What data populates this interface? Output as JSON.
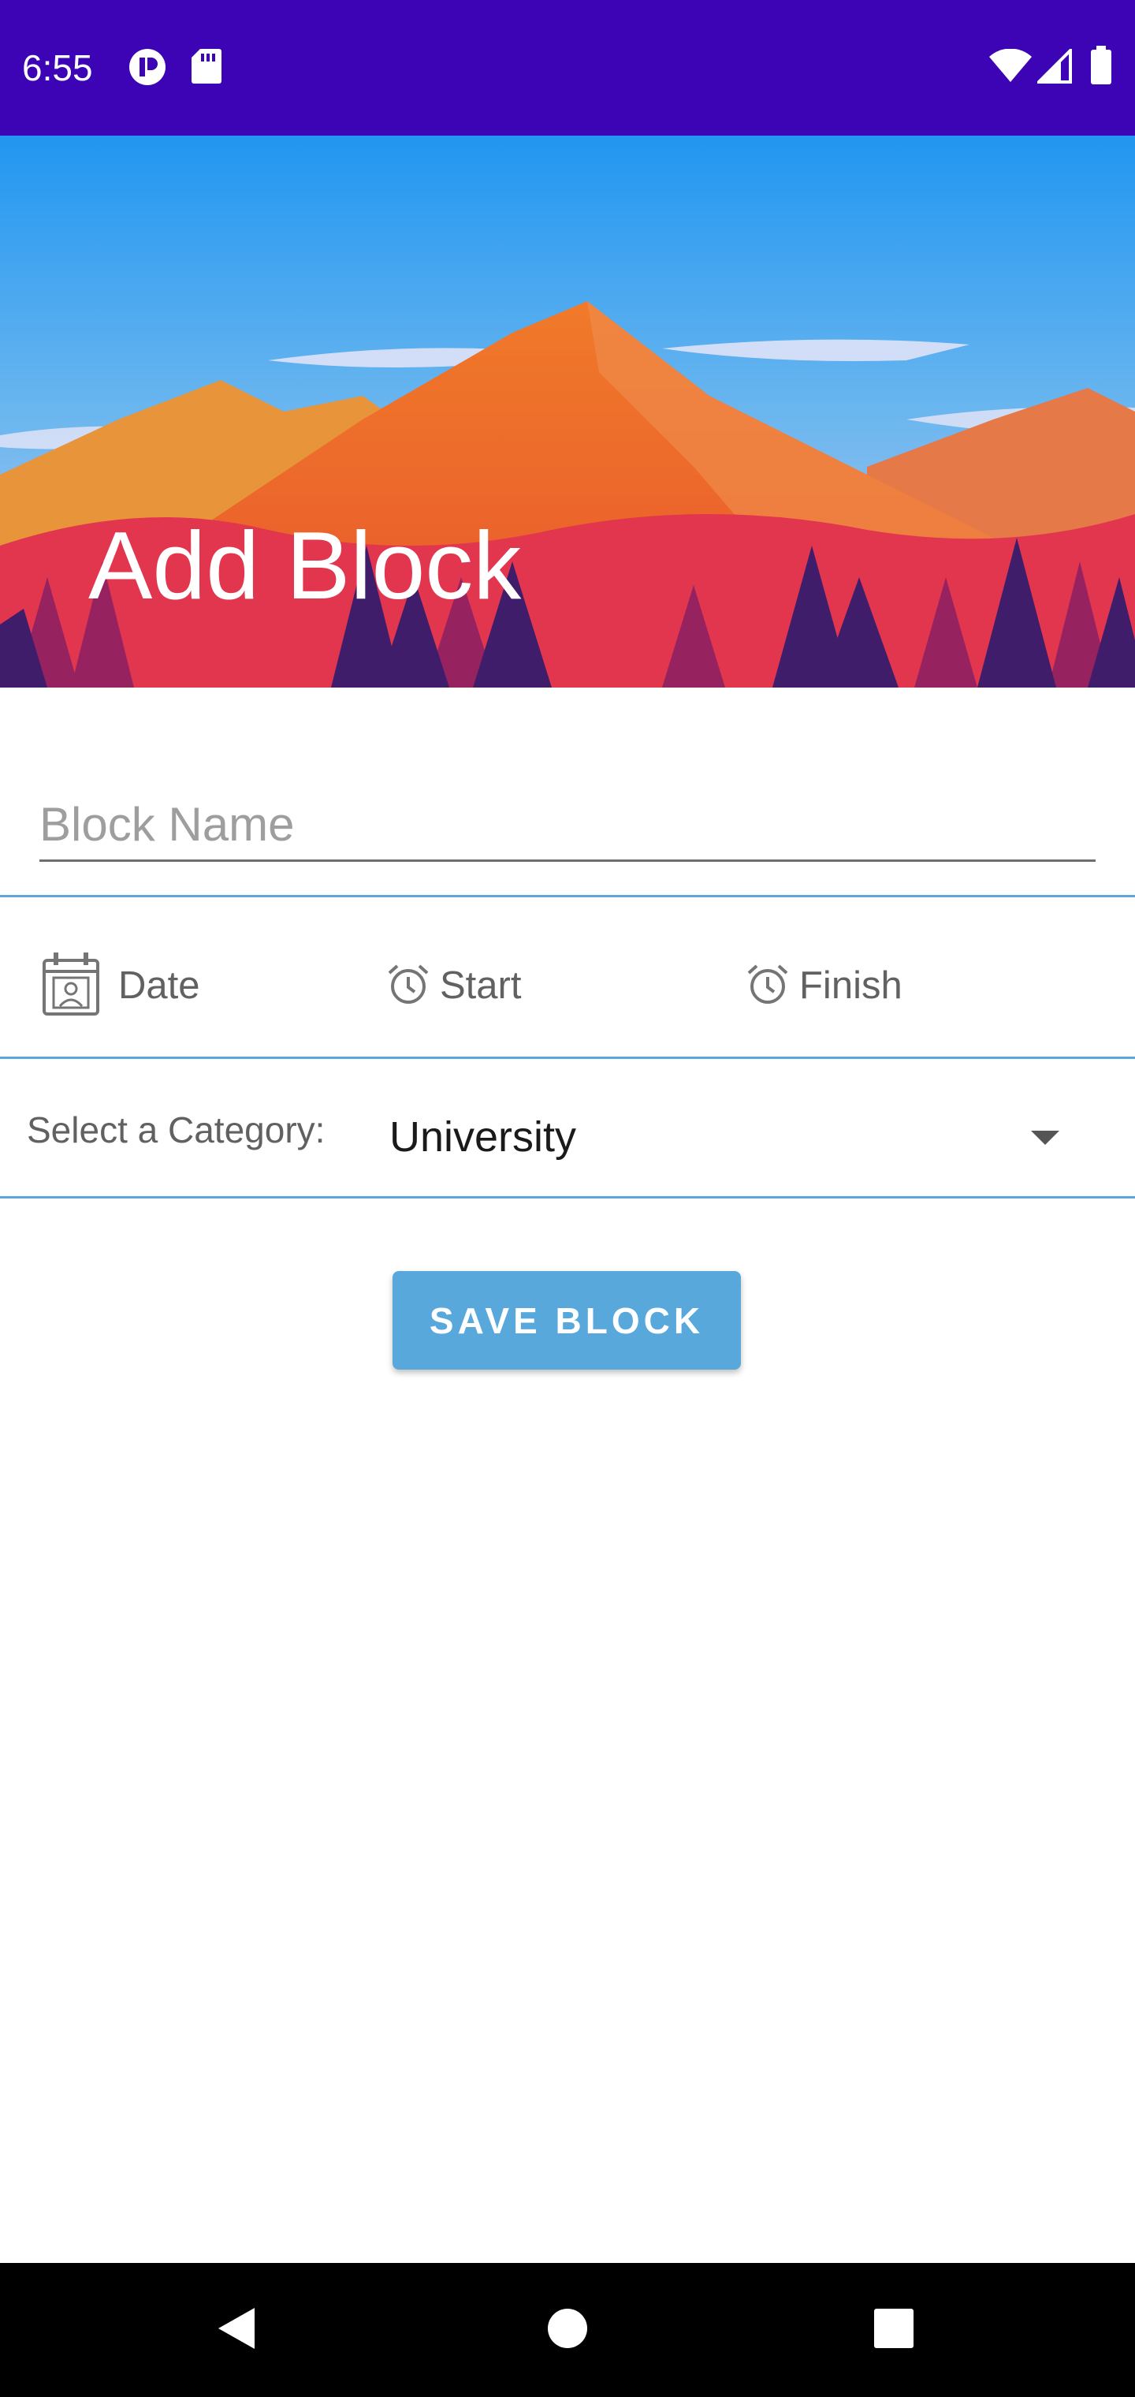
{
  "status_bar": {
    "time": "6:55",
    "icons": [
      "app-notification-icon",
      "sd-card-icon",
      "wifi-icon",
      "cellular-signal-icon",
      "battery-icon"
    ],
    "background_color": "#3c04b5"
  },
  "header": {
    "title": "Add Block"
  },
  "form": {
    "block_name_placeholder": "Block Name",
    "block_name_value": "",
    "date_label": "Date",
    "start_label": "Start",
    "finish_label": "Finish",
    "category_label": "Select a Category:",
    "category_selected": "University",
    "save_label": "SAVE BLOCK"
  },
  "colors": {
    "accent": "#58a8dc",
    "divider": "#5aa6dd"
  },
  "nav_bar": {
    "icons": [
      "back-icon",
      "home-icon",
      "recents-icon"
    ]
  }
}
